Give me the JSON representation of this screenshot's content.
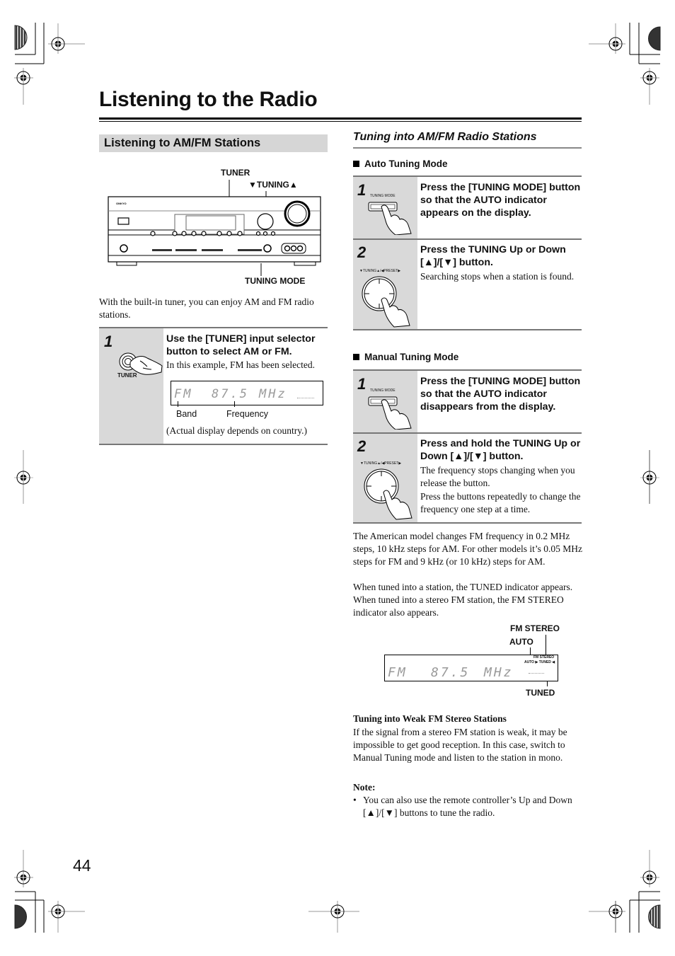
{
  "page": {
    "title": "Listening to the Radio",
    "page_number": "44"
  },
  "left": {
    "heading": "Listening to AM/FM Stations",
    "diagram": {
      "label_tuner": "TUNER",
      "label_tuning": "▼TUNING▲",
      "label_tuning_mode": "TUNING MODE",
      "brand": "ONKYO"
    },
    "intro": "With the built-in tuner, you can enjoy AM and FM radio stations.",
    "step1": {
      "number": "1",
      "icon_label": "TUNER",
      "title": "Use the [TUNER] input selector button to select AM or FM.",
      "text": "In this example, FM has been selected.",
      "display": {
        "band": "FM",
        "frequency": "87.5",
        "unit": "MHz"
      },
      "label_band": "Band",
      "label_frequency": "Frequency",
      "note": "(Actual display depends on country.)"
    }
  },
  "right": {
    "heading": "Tuning into AM/FM Radio Stations",
    "auto": {
      "heading": "Auto Tuning Mode",
      "step1": {
        "number": "1",
        "icon_label": "TUNING MODE",
        "title": "Press the [TUNING MODE] button so that the AUTO indicator appears on the display."
      },
      "step2": {
        "number": "2",
        "icon_label": "▼TUNING▲/◀PRESET▶",
        "title": "Press the TUNING Up or Down [▲]/[▼] button.",
        "text": "Searching stops when a station is found."
      }
    },
    "manual": {
      "heading": "Manual Tuning Mode",
      "step1": {
        "number": "1",
        "icon_label": "TUNING MODE",
        "title": "Press the [TUNING MODE] button so that the AUTO indicator disappears from the display."
      },
      "step2": {
        "number": "2",
        "icon_label": "▼TUNING▲/◀PRESET▶",
        "title": "Press and hold the TUNING Up or Down [▲]/[▼] button.",
        "text1": "The frequency stops changing when you release the button.",
        "text2": "Press the buttons repeatedly to change the frequency one step at a time."
      }
    },
    "steps_paragraph": "The American model changes FM frequency in 0.2 MHz steps, 10 kHz steps for AM. For other models it’s 0.05 MHz steps for FM and 9 kHz (or 10 kHz) steps for AM.",
    "tuned_paragraph": "When tuned into a station, the TUNED indicator appears. When tuned into a stereo FM station, the FM STEREO indicator also appears.",
    "indicator_diagram": {
      "label_fm_stereo": "FM STEREO",
      "label_auto": "AUTO",
      "label_tuned": "TUNED",
      "lcd_fm_stereo": "FM STEREO",
      "lcd_auto_tuned": "AUTO ▶ TUNED ◀",
      "display": {
        "band": "FM",
        "frequency": "87.5",
        "unit": "MHz"
      }
    },
    "weak": {
      "heading": "Tuning into Weak FM Stereo Stations",
      "text": "If the signal from a stereo FM station is weak, it may be impossible to get good reception. In this case, switch to Manual Tuning mode and listen to the station in mono."
    },
    "note": {
      "heading": "Note:",
      "bullet": "You can also use the remote controller’s Up and Down [▲]/[▼] buttons to tune the radio."
    }
  }
}
